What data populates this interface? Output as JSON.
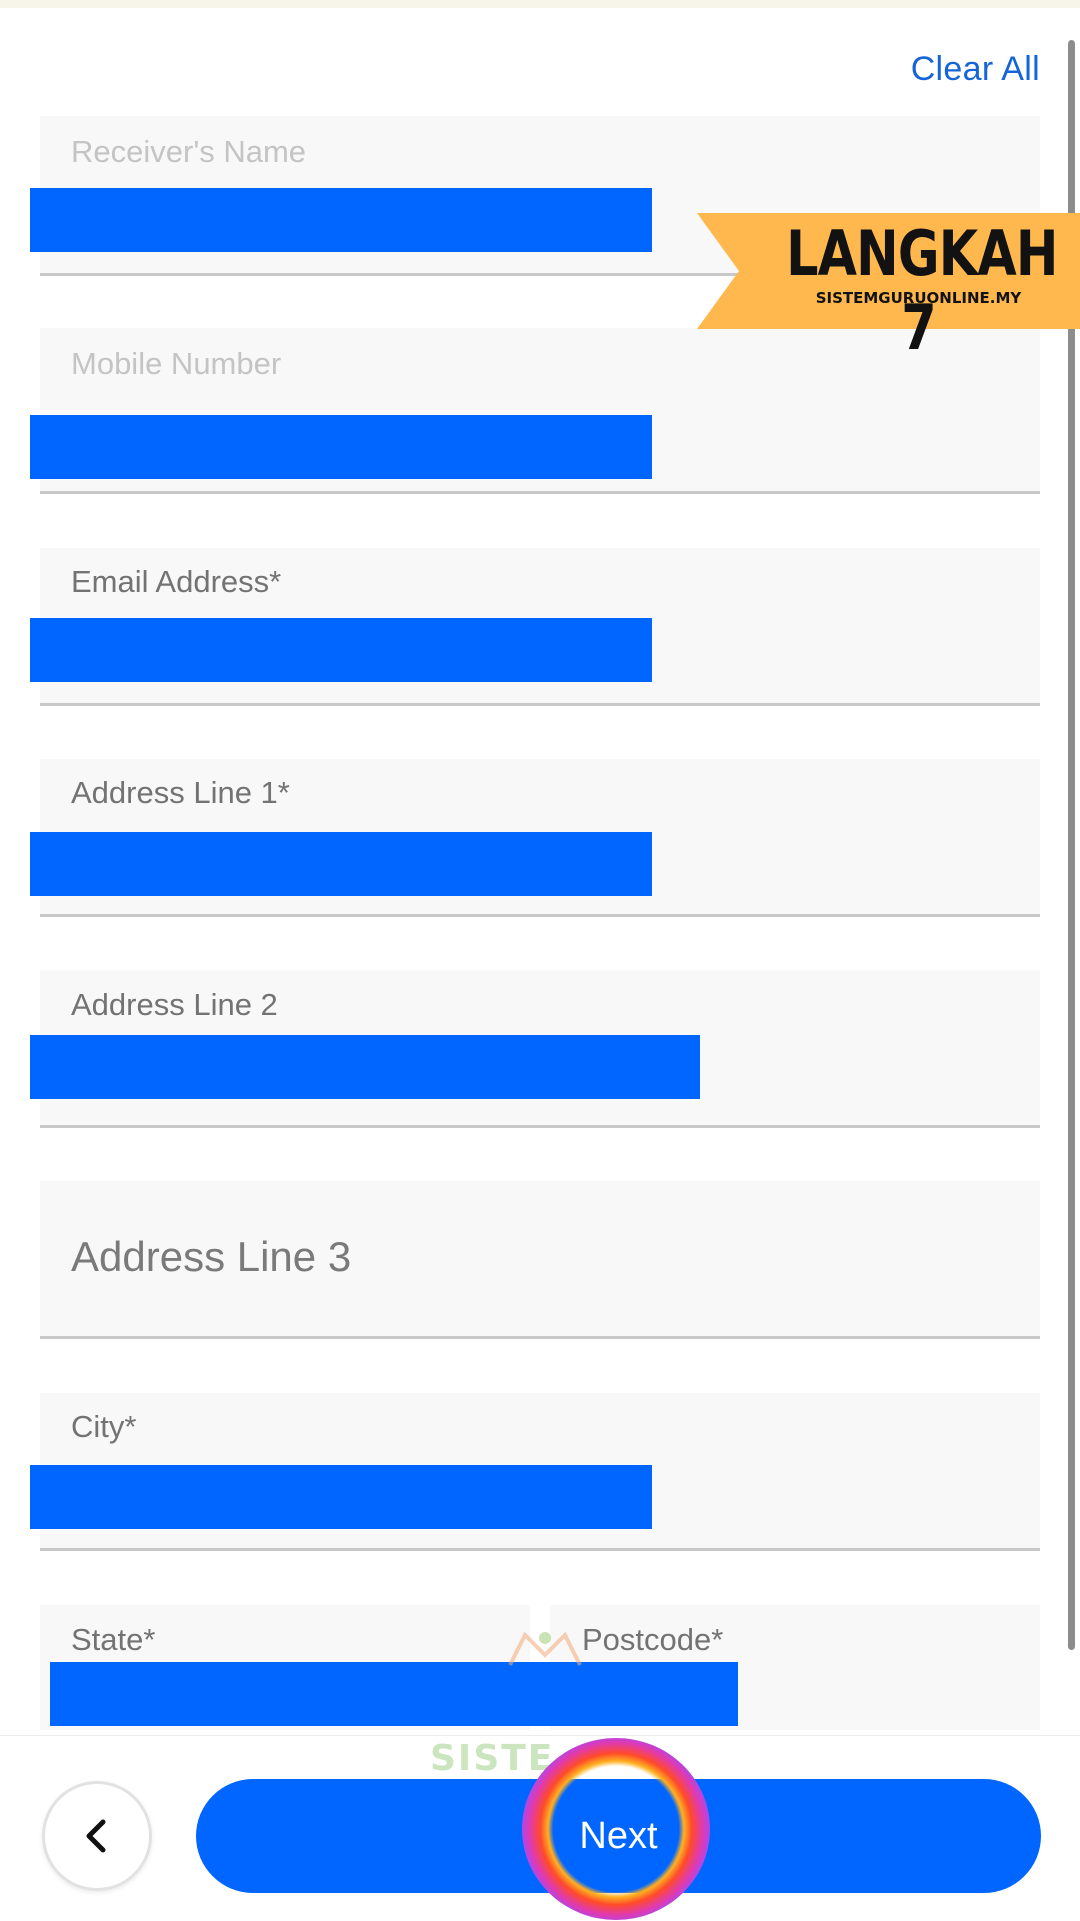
{
  "header": {
    "clear_all_label": "Clear All"
  },
  "form": {
    "receivers_name": {
      "label": "Receiver's Name"
    },
    "mobile_number": {
      "label": "Mobile Number"
    },
    "email_address": {
      "label": "Email Address*"
    },
    "address_line_1": {
      "label": "Address Line 1*"
    },
    "address_line_2": {
      "label": "Address Line 2"
    },
    "address_line_3": {
      "label": "Address Line 3"
    },
    "city": {
      "label": "City*"
    },
    "state": {
      "label": "State*"
    },
    "postcode": {
      "label": "Postcode*"
    }
  },
  "footer": {
    "back_icon": "chevron-left-icon",
    "next_label": "Next"
  },
  "banner": {
    "title": "LANGKAH 7",
    "subtitle": "SISTEMGURUONLINE.MY"
  },
  "watermark": {
    "text": "SISTE"
  },
  "colors": {
    "accent": "#0066ff",
    "link": "#1565d8",
    "banner": "#ffb84d",
    "redaction": "#0066ff"
  }
}
